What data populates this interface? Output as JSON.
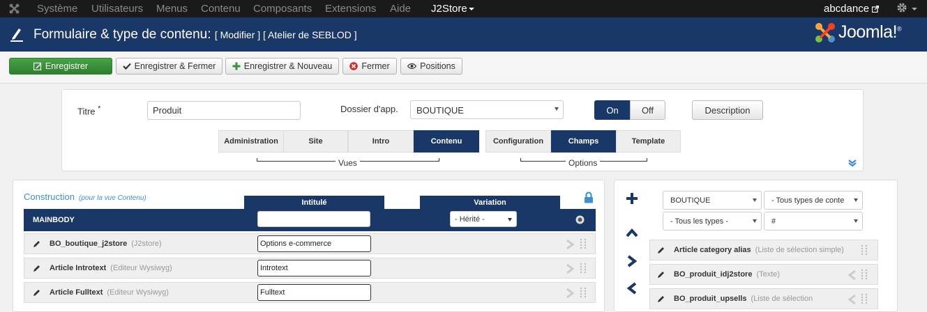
{
  "topnav": {
    "logo_icon": "joomla-icon",
    "items": [
      "Système",
      "Utilisateurs",
      "Menus",
      "Contenu",
      "Composants",
      "Extensions",
      "Aide"
    ],
    "active_item": "J2Store",
    "user": "abcdance",
    "settings_icon": "gear-icon"
  },
  "header": {
    "title": "Formulaire & type de contenu:",
    "subtitle": "[ Modifier ] [ Atelier de SEBLOD ]",
    "brand": "Joomla!",
    "brand_mark": "®"
  },
  "toolbar": {
    "save": "Enregistrer",
    "save_close": "Enregistrer & Fermer",
    "save_new": "Enregistrer & Nouveau",
    "close": "Fermer",
    "positions": "Positions"
  },
  "form": {
    "title_label": "Titre",
    "title_required": "*",
    "title_value": "Produit",
    "folder_label": "Dossier d'app.",
    "folder_value": "BOUTIQUE",
    "toggle_on": "On",
    "toggle_off": "Off",
    "toggle_state": "On",
    "description_button": "Description",
    "view_tabs": [
      "Administration",
      "Site",
      "Intro",
      "Contenu"
    ],
    "active_view": "Contenu",
    "views_label": "Vues",
    "option_tabs": [
      "Configuration",
      "Champs",
      "Template"
    ],
    "active_option": "Champs",
    "options_label": "Options"
  },
  "construction": {
    "title": "Construction",
    "hint": "(pour la vue Contenu)",
    "col_label": "Intitulé",
    "col_variation": "Variation",
    "mainbody": "MAINBODY",
    "mainbody_label_value": "",
    "variation_value": "- Hérité -",
    "rows": [
      {
        "name": "BO_boutique_j2store",
        "type": "(J2store)",
        "label": "Options e-commerce"
      },
      {
        "name": "Article Introtext",
        "type": "(Editeur Wysiwyg)",
        "label": "Introtext"
      },
      {
        "name": "Article Fulltext",
        "type": "(Editeur Wysiwyg)",
        "label": "Fulltext"
      }
    ]
  },
  "library": {
    "folder_filter": "BOUTIQUE",
    "content_types_filter": "- Tous types de conte",
    "types_filter": "- Tous les types -",
    "hash_filter": "#",
    "rows": [
      {
        "name": "Article category alias",
        "type": "(Liste de sélection simple)"
      },
      {
        "name": "BO_produit_idj2store",
        "type": "(Texte)"
      },
      {
        "name": "BO_produit_upsells",
        "type": "(Liste de sélection"
      }
    ]
  },
  "colors": {
    "navy": "#1a3867",
    "green": "#3e8f3e",
    "link_blue": "#3f8fd2"
  }
}
